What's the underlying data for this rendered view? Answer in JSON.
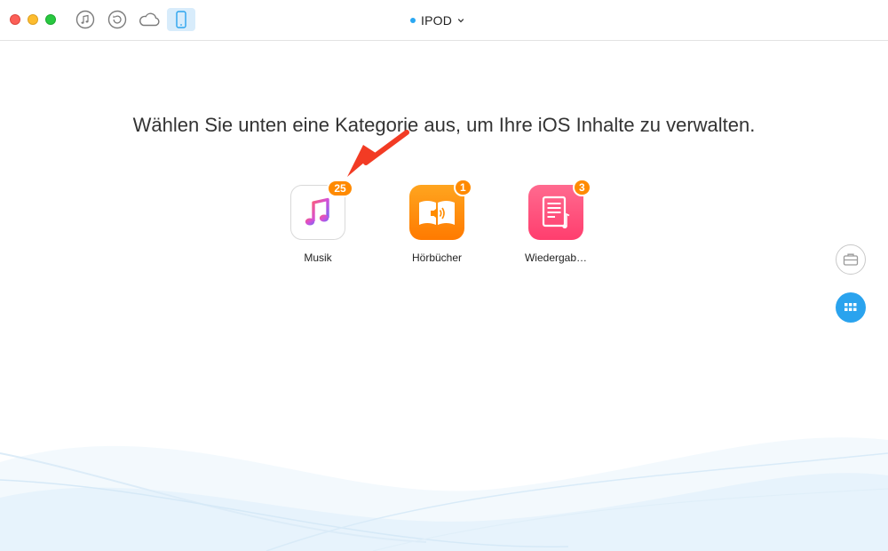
{
  "window": {
    "device_name": "IPOD"
  },
  "toolbar": {
    "icons": [
      "music-note-icon",
      "restore-icon",
      "cloud-icon",
      "device-icon"
    ],
    "active": "device-icon"
  },
  "main": {
    "headline": "Wählen Sie unten eine Kategorie aus, um Ihre iOS Inhalte zu verwalten.",
    "categories": [
      {
        "label": "Musik",
        "badge": "25",
        "icon": "apple-music-icon"
      },
      {
        "label": "Hörbücher",
        "badge": "1",
        "icon": "audiobook-icon"
      },
      {
        "label": "Wiedergab…",
        "badge": "3",
        "icon": "playlist-icon"
      }
    ]
  },
  "side": {
    "buttons": [
      "toolbox-icon",
      "apps-grid-icon"
    ]
  },
  "colors": {
    "accent": "#2aa3ee",
    "badge": "#ff8a00",
    "arrow": "#f23b24",
    "audio_icon": "#ff8c00",
    "playlist_icon": "#ff4f7b"
  }
}
